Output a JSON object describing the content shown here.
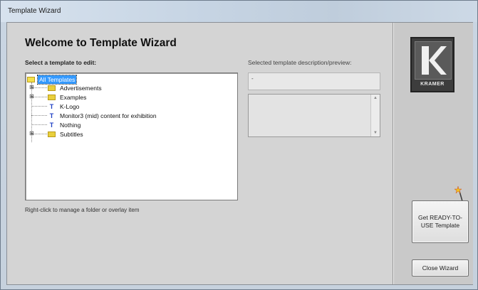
{
  "window": {
    "title": "Template Wizard"
  },
  "main": {
    "heading": "Welcome to Template Wizard",
    "select_label": "Select a template to edit:",
    "description_label": "Selected template description/preview:",
    "description_value": "-",
    "hint": "Right-click to manage a folder or overlay item"
  },
  "tree": {
    "root": {
      "label": "All Templates",
      "icon": "folder-icon",
      "selected": true
    },
    "items": [
      {
        "label": "Advertisements",
        "icon": "folder-icon",
        "expandable": true
      },
      {
        "label": "Examples",
        "icon": "folder-icon",
        "expandable": true
      },
      {
        "label": "K-Logo",
        "icon": "template-item-icon",
        "expandable": false
      },
      {
        "label": "Monitor3 (mid) content for exhibition",
        "icon": "template-item-icon",
        "expandable": false
      },
      {
        "label": "Nothing",
        "icon": "template-item-icon",
        "expandable": false
      },
      {
        "label": "Subtitles",
        "icon": "folder-icon",
        "expandable": true
      }
    ]
  },
  "sidebar": {
    "logo_text": "KRAMER",
    "ready_button": "Get READY-TO-USE Template",
    "close_button": "Close Wizard"
  },
  "colors": {
    "selection": "#3399ff",
    "folder": "#e9cf3c",
    "item_icon": "#1f3fc4"
  }
}
